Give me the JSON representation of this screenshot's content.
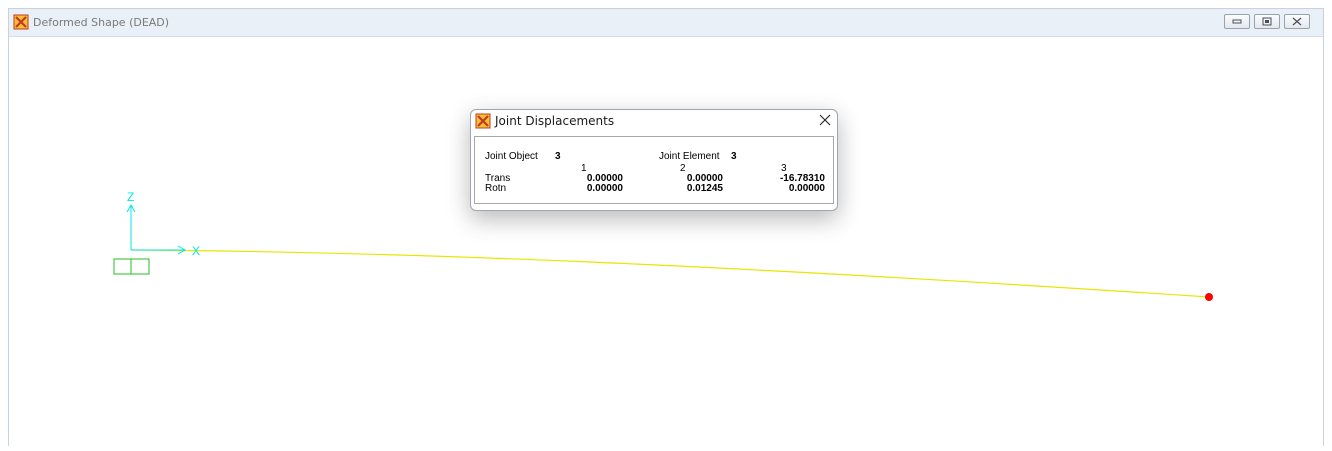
{
  "window": {
    "title": "Deformed Shape (DEAD)"
  },
  "axes": {
    "x_label": "X",
    "z_label": "Z"
  },
  "dialog": {
    "title": "Joint Displacements",
    "joint_object_label": "Joint Object",
    "joint_object_value": "3",
    "joint_element_label": "Joint Element",
    "joint_element_value": "3",
    "columns": [
      "1",
      "2",
      "3"
    ],
    "rows": [
      {
        "label": "Trans",
        "values": [
          "0.00000",
          "0.00000",
          "-16.78310"
        ]
      },
      {
        "label": "Rotn",
        "values": [
          "0.00000",
          "0.01245",
          "0.00000"
        ]
      }
    ]
  },
  "colors": {
    "beam": "#e6e600",
    "axes": "#00e6e6",
    "support": "#20c020",
    "selected_joint": "#ff0000",
    "app_icon": "#e8631a"
  }
}
